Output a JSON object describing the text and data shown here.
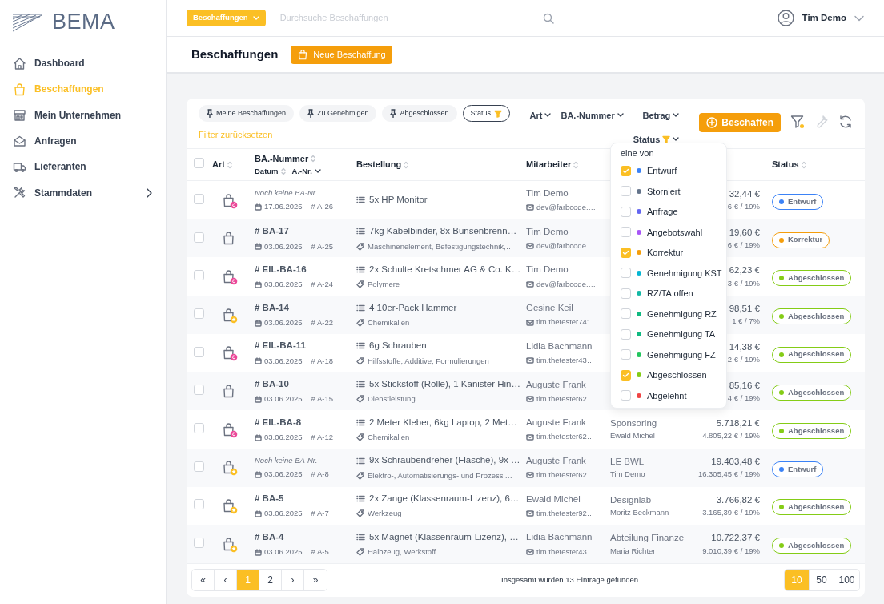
{
  "brand": "BEMA",
  "sidebar": {
    "items": [
      {
        "label": "Dashboard",
        "kind": "link",
        "selected": false
      },
      {
        "label": "Beschaffungen",
        "kind": "link",
        "selected": true
      },
      {
        "label": "Mein Unternehmen",
        "kind": "link",
        "selected": false
      },
      {
        "label": "Anfragen",
        "kind": "link",
        "selected": false
      },
      {
        "label": "Lieferanten",
        "kind": "link",
        "selected": false
      },
      {
        "label": "Stammdaten",
        "kind": "group",
        "selected": false
      }
    ]
  },
  "topbar": {
    "module": "Beschaffungen",
    "search": {
      "placeholder": "Durchsuche Beschaffungen"
    },
    "user": "Tim Demo"
  },
  "page": {
    "title": "Beschaffungen",
    "new_button": "Neue Beschaffung"
  },
  "filters": {
    "chips": [
      {
        "label": "Meine Beschaffungen",
        "kind": "pin",
        "selected": false
      },
      {
        "label": "Zu Genehmigen",
        "kind": "pin",
        "selected": false
      },
      {
        "label": "Abgeschlossen",
        "kind": "pin",
        "selected": false
      },
      {
        "label": "Status",
        "kind": "filter",
        "selected": true
      }
    ],
    "reset": "Filter zurücksetzen",
    "sorts": [
      {
        "label": "Art",
        "filtered": false
      },
      {
        "label": "BA.-Nummer",
        "filtered": false
      },
      {
        "label": "Betrag",
        "filtered": false
      },
      {
        "label": "Status",
        "filtered": true
      }
    ],
    "action": "Beschaffen",
    "filter_active": true,
    "settings_disabled": true
  },
  "table": {
    "header_checked": false,
    "columns": {
      "art": "Art",
      "number": "BA.-Nummer",
      "date": "Datum",
      "anr": "A.-Nr.",
      "order": "Bestellung",
      "employee": "Mitarbeiter",
      "status": "Status"
    },
    "rows": [
      {
        "checked": false,
        "kind": "flame",
        "ba": {
          "kind": "pending",
          "text": "Noch keine BA-Nr."
        },
        "date": "17.06.2025",
        "anr": "# A-26",
        "order": "5x HP Monitor",
        "employee": "Tim Demo",
        "email": "dev@farbcode.…",
        "amount": "32,44 €",
        "net": "6 € / 19%",
        "status": {
          "label": "Entwurf",
          "color": "#3b82f6"
        }
      },
      {
        "checked": false,
        "kind": "plain",
        "ba": {
          "kind": "number",
          "text": "# BA-17"
        },
        "date": "03.06.2025",
        "anr": "# A-25",
        "order": "7kg Kabelbinder, 8x Bunsenbrenn…",
        "tags": "Maschinenelement, Befestigungstechnik,…",
        "employee": "Tim Demo",
        "email": "dev@farbcode.…",
        "amount": "19,60 €",
        "net": "6 € / 19%",
        "status": {
          "label": "Korrektur",
          "color": "#f59e0b"
        }
      },
      {
        "checked": false,
        "kind": "flame",
        "ba": {
          "kind": "number",
          "text": "# EIL-BA-16"
        },
        "date": "03.06.2025",
        "anr": "# A-24",
        "order": "2x Schulte Kretschmer AG & Co. K…",
        "tags": "Polymere",
        "employee": "Tim Demo",
        "email": "dev@farbcode.…",
        "amount": "62,23 €",
        "net": "3 € / 19%",
        "status": {
          "label": "Abgeschlossen",
          "color": "#84cc16"
        }
      },
      {
        "checked": false,
        "kind": "star",
        "ba": {
          "kind": "number",
          "text": "# BA-14"
        },
        "date": "03.06.2025",
        "anr": "# A-22",
        "order": "4 10er-Pack Hammer",
        "tags": "Chemikalien",
        "employee": "Gesine Keil",
        "email": "tim.thetester741…",
        "amount": "98,51 €",
        "net": "1 € / 7%",
        "status": {
          "label": "Abgeschlossen",
          "color": "#84cc16"
        }
      },
      {
        "checked": false,
        "kind": "flame",
        "ba": {
          "kind": "number",
          "text": "# EIL-BA-11"
        },
        "date": "03.06.2025",
        "anr": "# A-18",
        "order": "6g Schrauben",
        "tags": "Hilfsstoffe, Additive, Formulierungen",
        "employee": "Lidia Bachmann",
        "email": "tim.thetester43…",
        "amount": "14,38 €",
        "net": "2 € / 19%",
        "status": {
          "label": "Abgeschlossen",
          "color": "#84cc16"
        }
      },
      {
        "checked": false,
        "kind": "plain",
        "ba": {
          "kind": "number",
          "text": "# BA-10"
        },
        "date": "03.06.2025",
        "anr": "# A-15",
        "order": "5x Stickstoff (Rolle), 1 Kanister Hin…",
        "tags": "Dienstleistung",
        "employee": "Auguste Frank",
        "email": "tim.thetester62…",
        "amount": "85,16 €",
        "net": "4 € / 19%",
        "status": {
          "label": "Abgeschlossen",
          "color": "#84cc16"
        }
      },
      {
        "checked": false,
        "kind": "flame",
        "ba": {
          "kind": "number",
          "text": "# EIL-BA-8"
        },
        "date": "03.06.2025",
        "anr": "# A-12",
        "order": "2 Meter Kleber, 6kg Laptop, 2 Met…",
        "tags": "Chemikalien",
        "employee": "Auguste Frank",
        "email": "tim.thetester62…",
        "cost_center": "Sponsoring",
        "cost_owner": "Ewald Michel",
        "amount": "5.718,21 €",
        "net": "4.805,22 € / 19%",
        "status": {
          "label": "Abgeschlossen",
          "color": "#84cc16"
        }
      },
      {
        "checked": false,
        "kind": "star",
        "ba": {
          "kind": "pending",
          "text": "Noch keine BA-Nr."
        },
        "date": "03.06.2025",
        "anr": "# A-8",
        "order": "9x Schraubendreher (Flasche), 9x …",
        "tags": "Elektro-, Automatisierungs- und Prozessl…",
        "employee": "Auguste Frank",
        "email": "tim.thetester62…",
        "cost_center": "LE BWL",
        "cost_owner": "Tim Demo",
        "amount": "19.403,48 €",
        "net": "16.305,45 € / 19%",
        "status": {
          "label": "Entwurf",
          "color": "#3b82f6"
        }
      },
      {
        "checked": false,
        "kind": "star",
        "ba": {
          "kind": "number",
          "text": "# BA-5"
        },
        "date": "03.06.2025",
        "anr": "# A-7",
        "order": "2x Zange (Klassenraum-Lizenz), 6…",
        "tags": "Werkzeug",
        "employee": "Ewald Michel",
        "email": "tim.thetester92…",
        "cost_center": "Designlab",
        "cost_owner": "Moritz Beckmann",
        "amount": "3.766,82 €",
        "net": "3.165,39 € / 19%",
        "status": {
          "label": "Abgeschlossen",
          "color": "#84cc16"
        }
      },
      {
        "checked": false,
        "kind": "star",
        "ba": {
          "kind": "number",
          "text": "# BA-4"
        },
        "date": "03.06.2025",
        "anr": "# A-5",
        "order": "5x Magnet (Klassenraum-Lizenz), …",
        "tags": "Halbzeug, Werkstoff",
        "employee": "Lidia Bachmann",
        "email": "tim.thetester43…",
        "cost_center": "Abteilung Finanze",
        "cost_owner": "Maria Richter",
        "amount": "10.722,37 €",
        "net": "9.010,39 € / 19%",
        "status": {
          "label": "Abgeschlossen",
          "color": "#84cc16"
        }
      }
    ]
  },
  "status_filter": {
    "title": "eine von",
    "items": [
      {
        "label": "Entwurf",
        "color": "#3b82f6",
        "checked": true
      },
      {
        "label": "Storniert",
        "color": "#64748b",
        "checked": false
      },
      {
        "label": "Anfrage",
        "color": "#6366f1",
        "checked": false
      },
      {
        "label": "Angebotswahl",
        "color": "#a855f7",
        "checked": false
      },
      {
        "label": "Korrektur",
        "color": "#f59e0b",
        "checked": true
      },
      {
        "label": "Genehmigung KST",
        "color": "#06b6d4",
        "checked": false
      },
      {
        "label": "RZ/TA offen",
        "color": "#14b8a6",
        "checked": false
      },
      {
        "label": "Genehmigung RZ",
        "color": "#10b981",
        "checked": false
      },
      {
        "label": "Genehmigung TA",
        "color": "#10b981",
        "checked": false
      },
      {
        "label": "Genehmigung FZ",
        "color": "#22c55e",
        "checked": false
      },
      {
        "label": "Abgeschlossen",
        "color": "#84cc16",
        "checked": true
      },
      {
        "label": "Abgelehnt",
        "color": "#ef4444",
        "checked": false
      }
    ]
  },
  "pagination": {
    "pages": [
      {
        "label": "«",
        "selected": false
      },
      {
        "label": "‹",
        "selected": false
      },
      {
        "label": "1",
        "selected": true
      },
      {
        "label": "2",
        "selected": false
      },
      {
        "label": "›",
        "selected": false
      },
      {
        "label": "»",
        "selected": false
      }
    ],
    "summary": "Insgesamt wurden 13 Einträge gefunden",
    "sizes": [
      {
        "label": "10",
        "selected": true
      },
      {
        "label": "50",
        "selected": false
      },
      {
        "label": "100",
        "selected": false
      }
    ]
  }
}
